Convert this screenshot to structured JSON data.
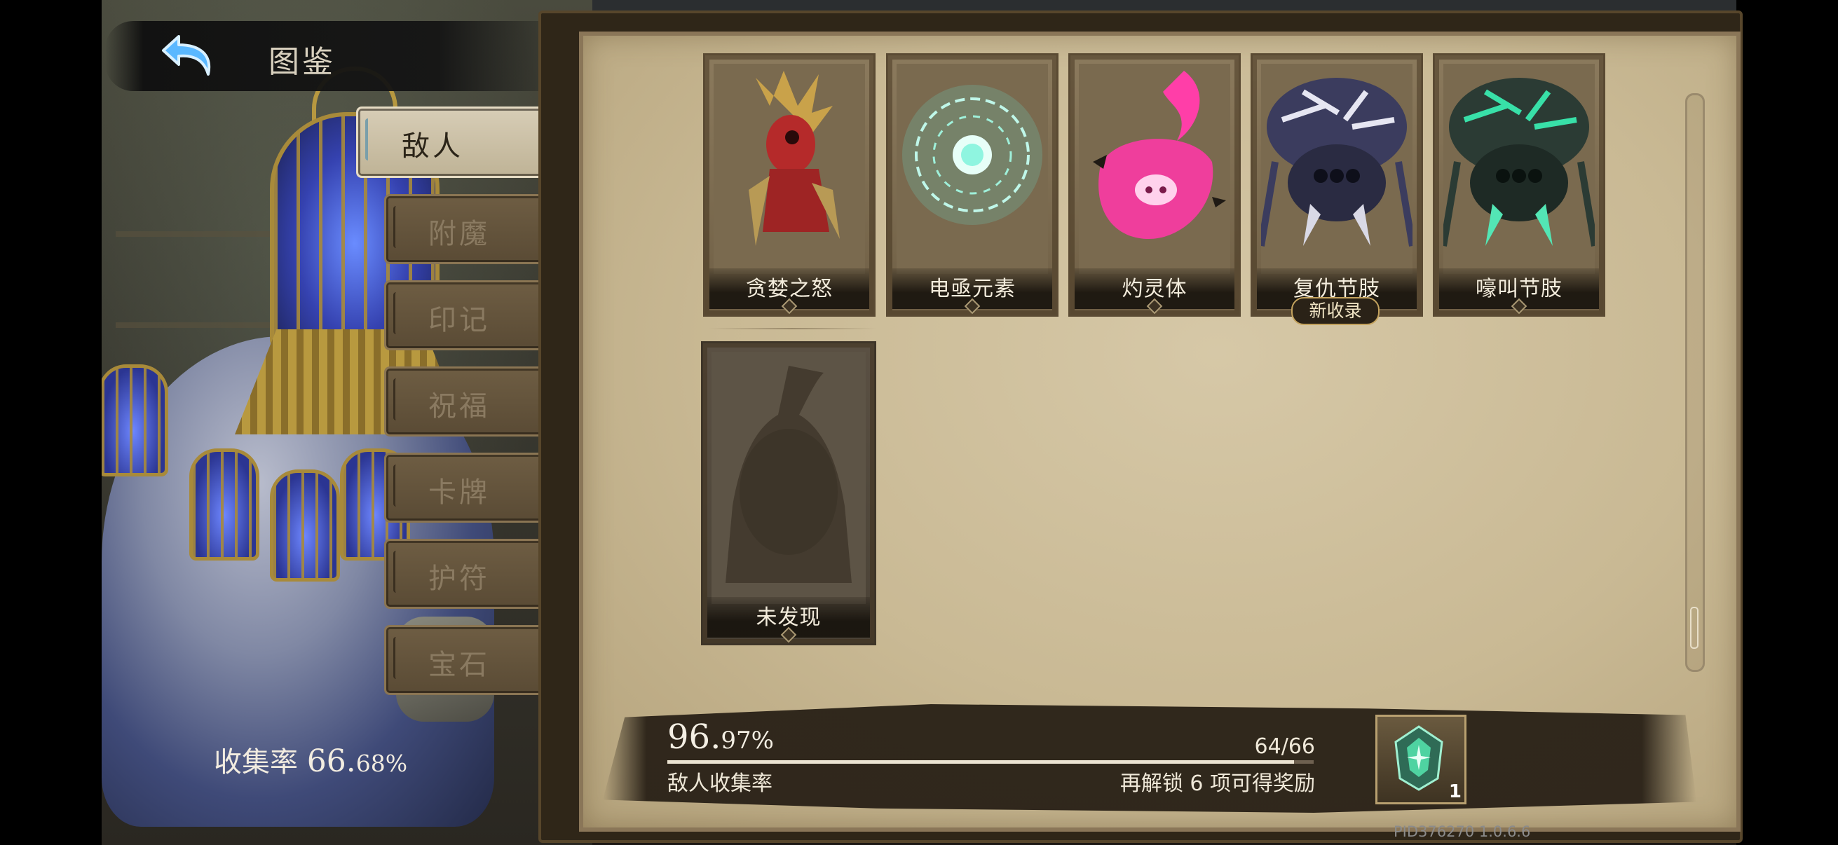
{
  "header": {
    "title": "图鉴",
    "back_icon": "back-arrow-icon"
  },
  "tabs": [
    {
      "label": "敌人",
      "active": true
    },
    {
      "label": "附魔",
      "active": false
    },
    {
      "label": "印记",
      "active": false
    },
    {
      "label": "祝福",
      "active": false
    },
    {
      "label": "卡牌",
      "active": false
    },
    {
      "label": "护符",
      "active": false
    },
    {
      "label": "宝石",
      "active": false
    }
  ],
  "overall": {
    "label": "收集率",
    "value_big": "66.",
    "value_small": "68%"
  },
  "cards": [
    {
      "name": "贪婪之怒"
    },
    {
      "name": "电亟元素"
    },
    {
      "name": "灼灵体"
    },
    {
      "name": "复仇节肢",
      "badge": "新收录"
    },
    {
      "name": "嚎叫节肢"
    },
    {
      "name": "未发现"
    }
  ],
  "footer": {
    "percent_big": "96.",
    "percent_small": "97%",
    "count": "64/66",
    "progress": 0.9697,
    "label": "敌人收集率",
    "hint": "再解锁 6 项可得奖励",
    "reward_count": "1",
    "reward_icon": "green-gem-icon"
  },
  "version": "PID376270  1.0.6.6",
  "colors": {
    "panel": "#c9b994",
    "active_tab": "#d7cdb6",
    "inactive_tab": "#5a4b35",
    "gold": "#b8993f"
  }
}
